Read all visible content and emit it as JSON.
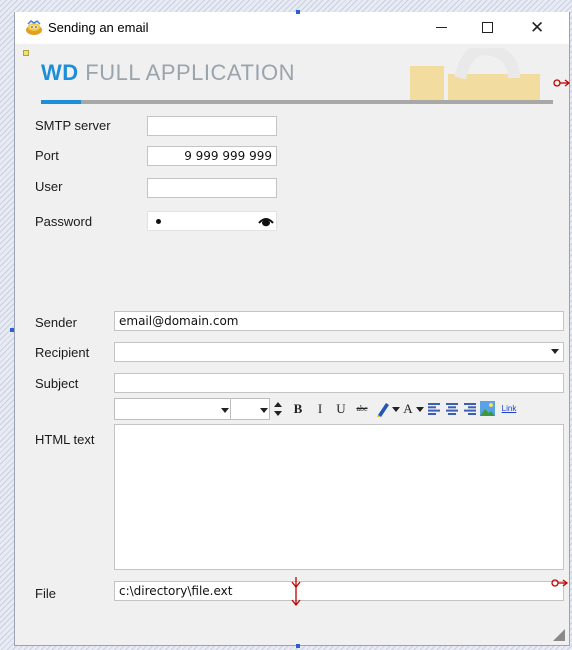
{
  "window": {
    "title": "Sending an email",
    "controls": {
      "minimize": "—",
      "maximize": "",
      "close": "✕"
    }
  },
  "banner": {
    "brand": "WD",
    "rest": " FULL APPLICATION"
  },
  "form": {
    "smtp_label": "SMTP server",
    "smtp_value": "",
    "port_label": "Port",
    "port_value": "9 999 999 999",
    "user_label": "User",
    "user_value": "",
    "password_label": "Password",
    "sender_label": "Sender",
    "sender_value": "email@domain.com",
    "recipient_label": "Recipient",
    "recipient_value": "",
    "subject_label": "Subject",
    "subject_value": "",
    "html_label": "HTML text",
    "html_value": "",
    "file_label": "File",
    "file_value": "c:\\directory\\file.ext"
  },
  "toolbar": {
    "bold": "B",
    "italic": "I",
    "underline": "U",
    "strike": "abc",
    "font_color": "A",
    "link": "Link"
  },
  "colors": {
    "accent": "#1d8fd8",
    "anchor_red": "#c00000",
    "watermark": "#f3d58a"
  }
}
